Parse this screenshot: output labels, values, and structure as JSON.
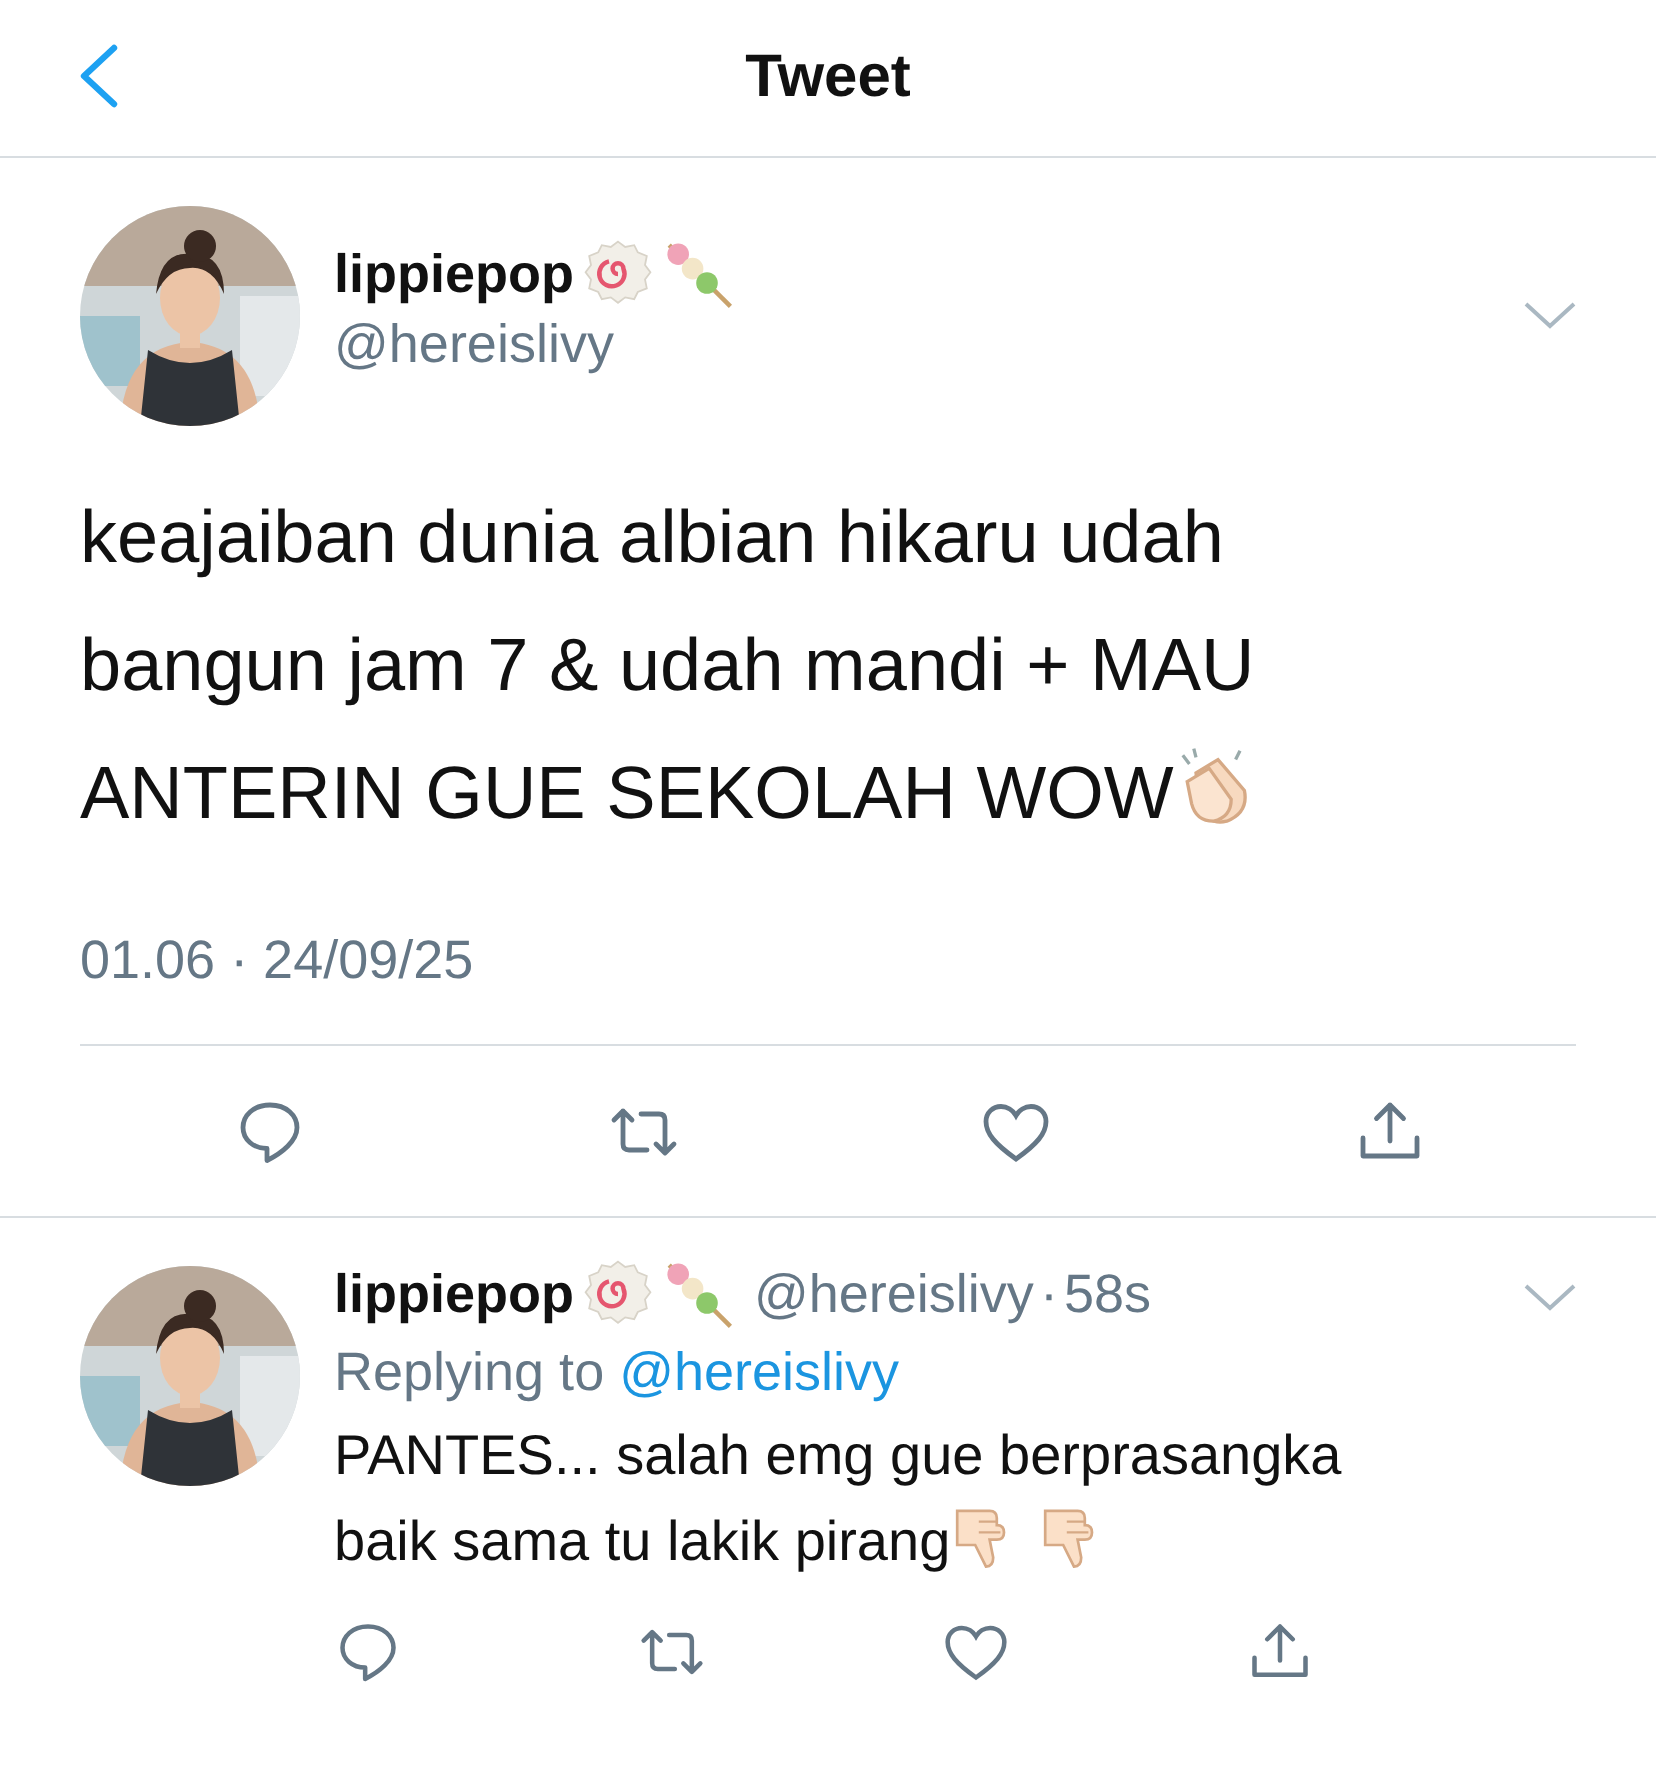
{
  "header": {
    "title": "Tweet"
  },
  "tweet": {
    "name": "lippiepop",
    "handle": "@hereislivy",
    "text_lines": [
      "keajaiban dunia albian hikaru udah",
      "bangun jam 7 & udah mandi + MAU",
      "ANTERIN GUE SEKOLAH WOW"
    ],
    "timestamp": "01.06 · 24/09/25"
  },
  "reply": {
    "name": "lippiepop",
    "handle": "@hereislivy",
    "separator": "·",
    "age": "58s",
    "replying_label": "Replying to",
    "replying_to": "@hereislivy",
    "text_lines": [
      "PANTES... salah emg gue berprasangka",
      "baik sama tu lakik pirang"
    ]
  }
}
